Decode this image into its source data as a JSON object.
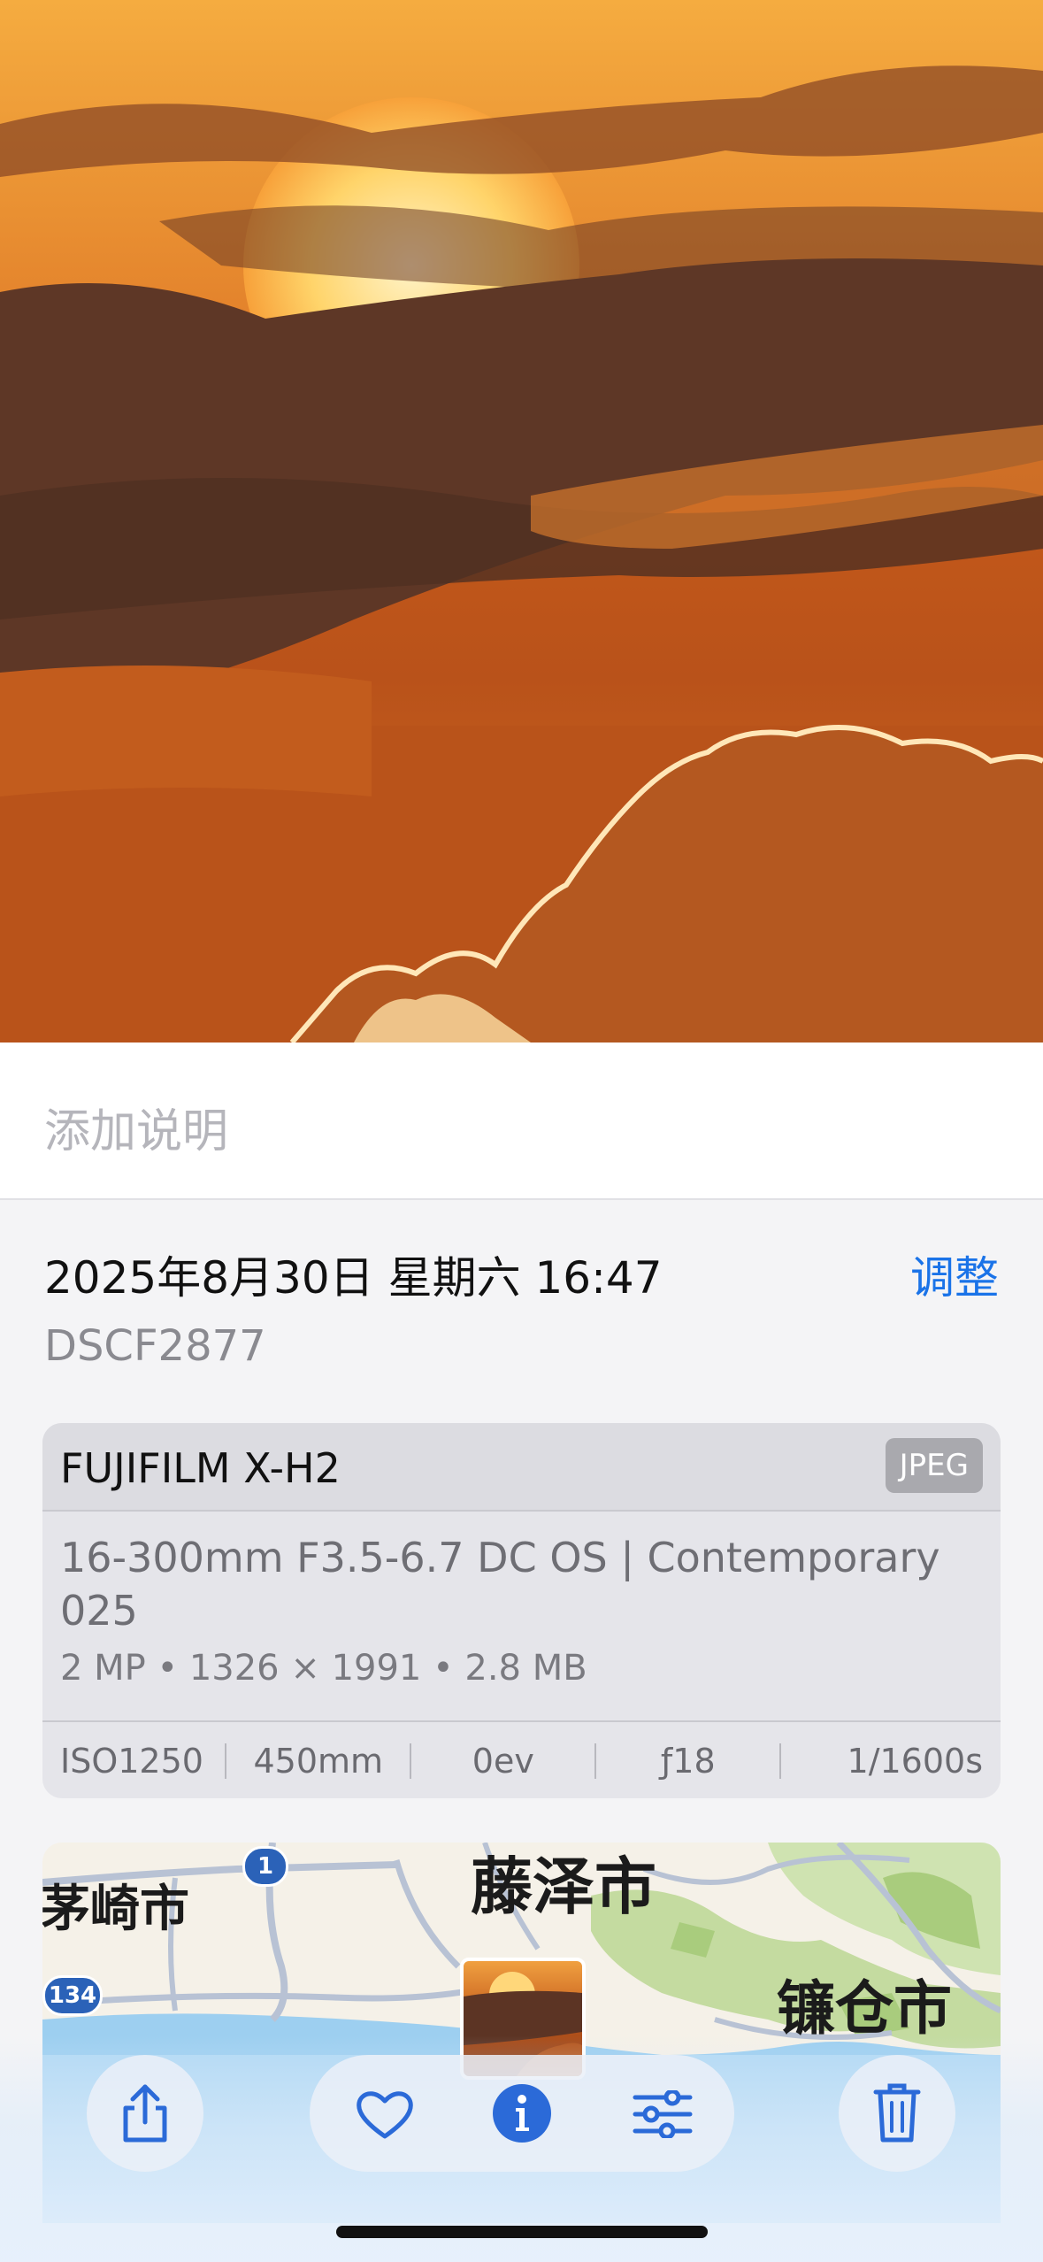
{
  "caption": {
    "placeholder": "添加说明"
  },
  "info": {
    "date_time": "2025年8月30日 星期六 16:47",
    "adjust_label": "调整",
    "filename": "DSCF2877"
  },
  "exif": {
    "camera": "FUJIFILM X-H2",
    "format": "JPEG",
    "lens": "16-300mm F3.5-6.7 DC OS | Contemporary 025",
    "specs": "2 MP • 1326 × 1991 • 2.8 MB",
    "iso": "ISO1250",
    "focal_length": "450mm",
    "exposure_comp": "0ev",
    "aperture": "ƒ18",
    "shutter": "1/1600s"
  },
  "map": {
    "cities": [
      "茅崎市",
      "藤泽市",
      "镰仓市"
    ],
    "routes": [
      "1",
      "134"
    ]
  },
  "toolbar": {
    "icons": [
      "share-icon",
      "heart-icon",
      "info-icon",
      "adjust-icon",
      "trash-icon"
    ],
    "accent": "#2b6ad8"
  }
}
